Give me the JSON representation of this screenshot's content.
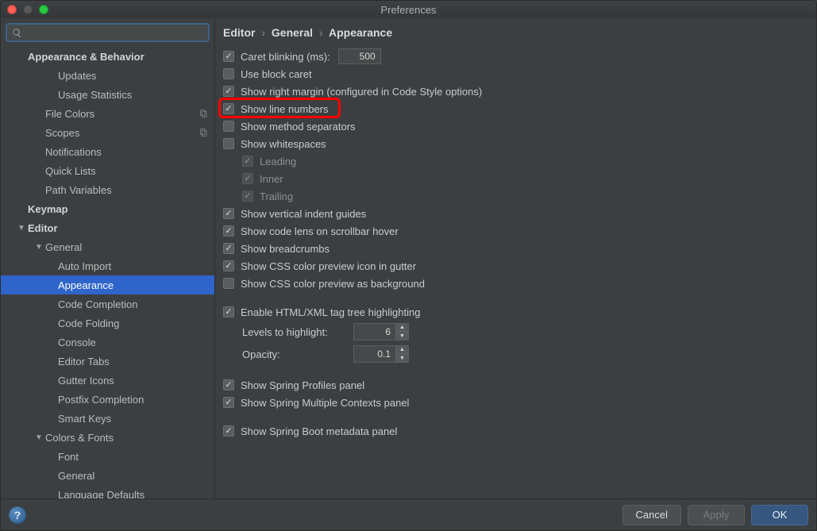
{
  "window": {
    "title": "Preferences"
  },
  "search": {
    "placeholder": ""
  },
  "sidebar": {
    "items": [
      {
        "label": "Appearance & Behavior",
        "level": 0,
        "section": true,
        "arrow": ""
      },
      {
        "label": "Updates",
        "level": 2
      },
      {
        "label": "Usage Statistics",
        "level": 2
      },
      {
        "label": "File Colors",
        "level": 1,
        "copy": true
      },
      {
        "label": "Scopes",
        "level": 1,
        "copy": true
      },
      {
        "label": "Notifications",
        "level": 1
      },
      {
        "label": "Quick Lists",
        "level": 1
      },
      {
        "label": "Path Variables",
        "level": 1
      },
      {
        "label": "Keymap",
        "level": 0,
        "section": true
      },
      {
        "label": "Editor",
        "level": 0,
        "section": true,
        "arrow": "down"
      },
      {
        "label": "General",
        "level": 1,
        "arrow": "down"
      },
      {
        "label": "Auto Import",
        "level": 2
      },
      {
        "label": "Appearance",
        "level": 2,
        "selected": true
      },
      {
        "label": "Code Completion",
        "level": 2
      },
      {
        "label": "Code Folding",
        "level": 2
      },
      {
        "label": "Console",
        "level": 2
      },
      {
        "label": "Editor Tabs",
        "level": 2
      },
      {
        "label": "Gutter Icons",
        "level": 2
      },
      {
        "label": "Postfix Completion",
        "level": 2
      },
      {
        "label": "Smart Keys",
        "level": 2
      },
      {
        "label": "Colors & Fonts",
        "level": 1,
        "arrow": "down"
      },
      {
        "label": "Font",
        "level": 2
      },
      {
        "label": "General",
        "level": 2
      },
      {
        "label": "Language Defaults",
        "level": 2
      }
    ]
  },
  "breadcrumb": [
    "Editor",
    "General",
    "Appearance"
  ],
  "settings": {
    "caretBlinking": {
      "label": "Caret blinking (ms):",
      "checked": true,
      "value": "500"
    },
    "useBlockCaret": {
      "label": "Use block caret",
      "checked": false
    },
    "showRightMargin": {
      "label": "Show right margin (configured in Code Style options)",
      "checked": true
    },
    "showLineNumbers": {
      "label": "Show line numbers",
      "checked": true
    },
    "showMethodSeparators": {
      "label": "Show method separators",
      "checked": false
    },
    "showWhitespaces": {
      "label": "Show whitespaces",
      "checked": false
    },
    "wsLeading": {
      "label": "Leading",
      "checked": true,
      "disabled": true
    },
    "wsInner": {
      "label": "Inner",
      "checked": true,
      "disabled": true
    },
    "wsTrailing": {
      "label": "Trailing",
      "checked": true,
      "disabled": true
    },
    "verticalIndent": {
      "label": "Show vertical indent guides",
      "checked": true
    },
    "codeLens": {
      "label": "Show code lens on scrollbar hover",
      "checked": true
    },
    "breadcrumbs": {
      "label": "Show breadcrumbs",
      "checked": true
    },
    "cssGutter": {
      "label": "Show CSS color preview icon in gutter",
      "checked": true
    },
    "cssBackground": {
      "label": "Show CSS color preview as background",
      "checked": false
    },
    "enableTagTree": {
      "label": "Enable HTML/XML tag tree highlighting",
      "checked": true
    },
    "levels": {
      "label": "Levels to highlight:",
      "value": "6"
    },
    "opacity": {
      "label": "Opacity:",
      "value": "0.1"
    },
    "springProfiles": {
      "label": "Show Spring Profiles panel",
      "checked": true
    },
    "springContexts": {
      "label": "Show Spring Multiple Contexts panel",
      "checked": true
    },
    "springBoot": {
      "label": "Show Spring Boot metadata panel",
      "checked": true
    }
  },
  "buttons": {
    "cancel": "Cancel",
    "apply": "Apply",
    "ok": "OK"
  }
}
